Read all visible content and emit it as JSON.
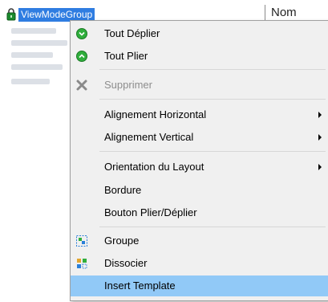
{
  "tree": {
    "node_label": "ViewModeGroup",
    "column_header": "Nom"
  },
  "menu": {
    "items": [
      {
        "label": "Tout Déplier",
        "icon": "expand-all-icon"
      },
      {
        "label": "Tout Plier",
        "icon": "collapse-all-icon"
      },
      {
        "label": "Supprimer",
        "icon": "delete-icon",
        "disabled": true
      },
      {
        "label": "Alignement Horizontal",
        "submenu": true
      },
      {
        "label": "Alignement Vertical",
        "submenu": true
      },
      {
        "label": "Orientation du Layout",
        "submenu": true
      },
      {
        "label": "Bordure"
      },
      {
        "label": "Bouton Plier/Déplier"
      },
      {
        "label": "Groupe",
        "icon": "group-icon"
      },
      {
        "label": "Dissocier",
        "icon": "ungroup-icon"
      },
      {
        "label": "Insert Template",
        "selected": true
      }
    ]
  },
  "colors": {
    "selection_blue": "#2f7de1",
    "menu_highlight": "#91c9f7",
    "menu_background": "#f0f0f0",
    "green_icon": "#2fae3c"
  }
}
